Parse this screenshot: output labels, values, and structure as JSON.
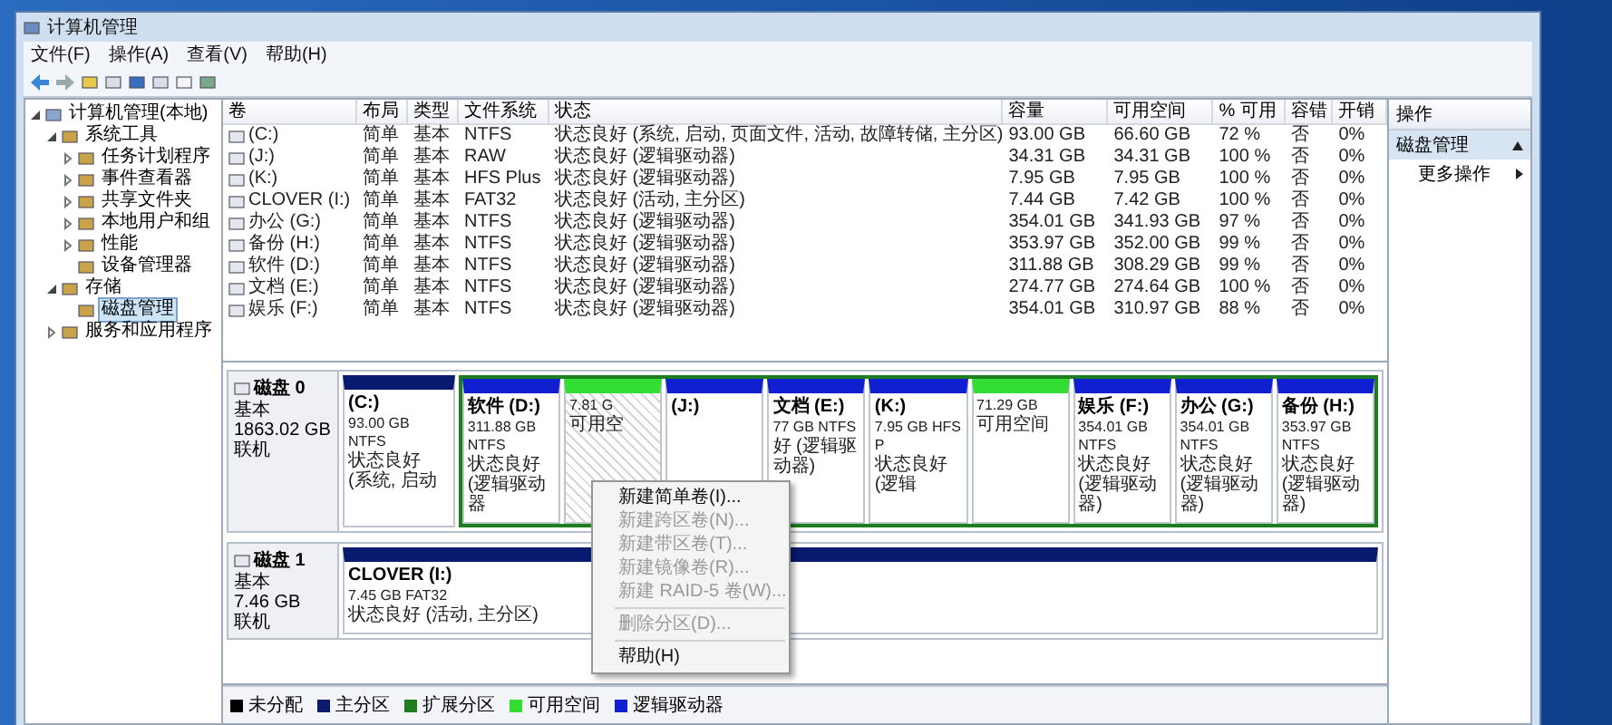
{
  "window": {
    "title": "计算机管理"
  },
  "menu": [
    "文件(F)",
    "操作(A)",
    "查看(V)",
    "帮助(H)"
  ],
  "tree": {
    "items": [
      {
        "label": "计算机管理(本地)",
        "selected": false,
        "expanded": true,
        "children": [
          {
            "label": "系统工具",
            "selected": false,
            "expanded": true,
            "children": [
              {
                "label": "任务计划程序",
                "selected": false,
                "expanded": false
              },
              {
                "label": "事件查看器",
                "selected": false,
                "expanded": false
              },
              {
                "label": "共享文件夹",
                "selected": false,
                "expanded": false
              },
              {
                "label": "本地用户和组",
                "selected": false,
                "expanded": false
              },
              {
                "label": "性能",
                "selected": false,
                "expanded": false
              },
              {
                "label": "设备管理器",
                "selected": false
              }
            ]
          },
          {
            "label": "存储",
            "selected": false,
            "expanded": true,
            "children": [
              {
                "label": "磁盘管理",
                "selected": true
              }
            ]
          },
          {
            "label": "服务和应用程序",
            "selected": false,
            "expanded": false
          }
        ]
      }
    ]
  },
  "table": {
    "columns": [
      "卷",
      "布局",
      "类型",
      "文件系统",
      "状态",
      "容量",
      "可用空间",
      "% 可用",
      "容错",
      "开销"
    ],
    "rows": [
      [
        "(C:)",
        "简单",
        "基本",
        "NTFS",
        "状态良好 (系统, 启动, 页面文件, 活动, 故障转储, 主分区)",
        "93.00 GB",
        "66.60 GB",
        "72 %",
        "否",
        "0%"
      ],
      [
        "(J:)",
        "简单",
        "基本",
        "RAW",
        "状态良好 (逻辑驱动器)",
        "34.31 GB",
        "34.31 GB",
        "100 %",
        "否",
        "0%"
      ],
      [
        "(K:)",
        "简单",
        "基本",
        "HFS Plus",
        "状态良好 (逻辑驱动器)",
        "7.95 GB",
        "7.95 GB",
        "100 %",
        "否",
        "0%"
      ],
      [
        "CLOVER (I:)",
        "简单",
        "基本",
        "FAT32",
        "状态良好 (活动, 主分区)",
        "7.44 GB",
        "7.42 GB",
        "100 %",
        "否",
        "0%"
      ],
      [
        "办公 (G:)",
        "简单",
        "基本",
        "NTFS",
        "状态良好 (逻辑驱动器)",
        "354.01 GB",
        "341.93 GB",
        "97 %",
        "否",
        "0%"
      ],
      [
        "备份 (H:)",
        "简单",
        "基本",
        "NTFS",
        "状态良好 (逻辑驱动器)",
        "353.97 GB",
        "352.00 GB",
        "99 %",
        "否",
        "0%"
      ],
      [
        "软件 (D:)",
        "简单",
        "基本",
        "NTFS",
        "状态良好 (逻辑驱动器)",
        "311.88 GB",
        "308.29 GB",
        "99 %",
        "否",
        "0%"
      ],
      [
        "文档 (E:)",
        "简单",
        "基本",
        "NTFS",
        "状态良好 (逻辑驱动器)",
        "274.77 GB",
        "274.64 GB",
        "100 %",
        "否",
        "0%"
      ],
      [
        "娱乐 (F:)",
        "简单",
        "基本",
        "NTFS",
        "状态良好 (逻辑驱动器)",
        "354.01 GB",
        "310.97 GB",
        "88 %",
        "否",
        "0%"
      ]
    ]
  },
  "disks": [
    {
      "name": "磁盘 0",
      "type": "基本",
      "size": "1863.02 GB",
      "status": "联机",
      "partitions": [
        {
          "kind": "primary",
          "selected": false,
          "label": "(C:)",
          "size": "93.00 GB NTFS",
          "status": "状态良好 (系统, 启动"
        },
        {
          "kind": "extended",
          "partitions": [
            {
              "kind": "logical",
              "selected": false,
              "label": "软件 (D:)",
              "size": "311.88 GB NTFS",
              "status": "状态良好 (逻辑驱动器"
            },
            {
              "kind": "free",
              "selected": true,
              "size": "7.81 G",
              "status": "可用空"
            },
            {
              "kind": "logical",
              "selected": false,
              "label": "(J:)"
            },
            {
              "kind": "logical",
              "selected": false,
              "label": "文档 (E:)",
              "size": "77 GB NTFS",
              "status": "好 (逻辑驱动器)"
            },
            {
              "kind": "logical",
              "selected": false,
              "label": "(K:)",
              "size": "7.95 GB HFS P",
              "status": "状态良好 (逻辑"
            },
            {
              "kind": "free",
              "selected": false,
              "size": "71.29 GB",
              "status": "可用空间"
            },
            {
              "kind": "logical",
              "selected": false,
              "label": "娱乐 (F:)",
              "size": "354.01 GB NTFS",
              "status": "状态良好 (逻辑驱动器)"
            },
            {
              "kind": "logical",
              "selected": false,
              "label": "办公 (G:)",
              "size": "354.01 GB NTFS",
              "status": "状态良好 (逻辑驱动器)"
            },
            {
              "kind": "logical",
              "selected": false,
              "label": "备份 (H:)",
              "size": "353.97 GB NTFS",
              "status": "状态良好 (逻辑驱动器)"
            }
          ]
        }
      ]
    },
    {
      "name": "磁盘 1",
      "type": "基本",
      "size": "7.46 GB",
      "status": "联机",
      "partitions": [
        {
          "kind": "primary",
          "selected": false,
          "label": "CLOVER (I:)",
          "size": "7.45 GB FAT32",
          "status": "状态良好 (活动, 主分区)"
        }
      ]
    }
  ],
  "context_menu": [
    {
      "kind": "item",
      "label": "新建简单卷(I)...",
      "disabled": false
    },
    {
      "kind": "item",
      "label": "新建跨区卷(N)...",
      "disabled": true
    },
    {
      "kind": "item",
      "label": "新建带区卷(T)...",
      "disabled": true
    },
    {
      "kind": "item",
      "label": "新建镜像卷(R)...",
      "disabled": true
    },
    {
      "kind": "item",
      "label": "新建 RAID-5 卷(W)...",
      "disabled": true
    },
    {
      "kind": "separator"
    },
    {
      "kind": "item",
      "label": "删除分区(D)...",
      "disabled": true
    },
    {
      "kind": "separator"
    },
    {
      "kind": "item",
      "label": "帮助(H)",
      "disabled": false
    }
  ],
  "legend": [
    {
      "label": "未分配",
      "color": "#000000"
    },
    {
      "label": "主分区",
      "color": "#0a1a6e"
    },
    {
      "label": "扩展分区",
      "color": "#1e7d1e"
    },
    {
      "label": "可用空间",
      "color": "#33dd33"
    },
    {
      "label": "逻辑驱动器",
      "color": "#1020d0"
    }
  ],
  "actions": {
    "title": "操作",
    "section": "磁盘管理",
    "items": [
      "更多操作"
    ]
  }
}
